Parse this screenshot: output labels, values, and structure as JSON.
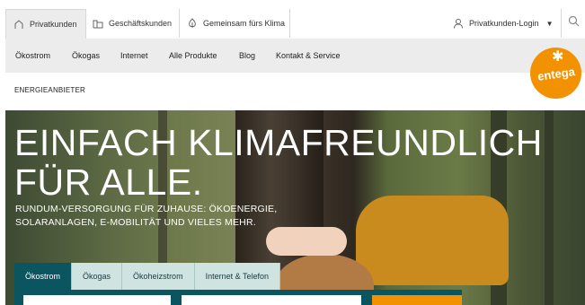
{
  "topbar": {
    "tabs": [
      {
        "label": "Privatkunden",
        "icon": "house-icon"
      },
      {
        "label": "Geschäftskunden",
        "icon": "office-icon"
      },
      {
        "label": "Gemeinsam fürs Klima",
        "icon": "leaf-icon"
      }
    ],
    "login_label": "Privatkunden-Login"
  },
  "nav": {
    "items": [
      "Ökostrom",
      "Ökogas",
      "Internet",
      "Alle Produkte",
      "Blog",
      "Kontakt & Service"
    ]
  },
  "logo": {
    "text": "entega",
    "color": "#f29200"
  },
  "subheader": {
    "label": "ENERGIEANBIETER"
  },
  "hero": {
    "headline_line1": "EINFACH KLIMAFREUNDLICH",
    "headline_line2": "FÜR ALLE.",
    "subline_line1": "RUNDUM-VERSORGUNG FÜR ZUHAUSE: ÖKOENERGIE,",
    "subline_line2": "SOLARANLAGEN, E-MOBILITÄT UND VIELES MEHR."
  },
  "product_tabs": [
    "Ökostrom",
    "Ökogas",
    "Ökoheizstrom",
    "Internet & Telefon"
  ],
  "colors": {
    "accent": "#f29200",
    "teal": "#0b5561",
    "teal_light": "#cfe3e0"
  }
}
